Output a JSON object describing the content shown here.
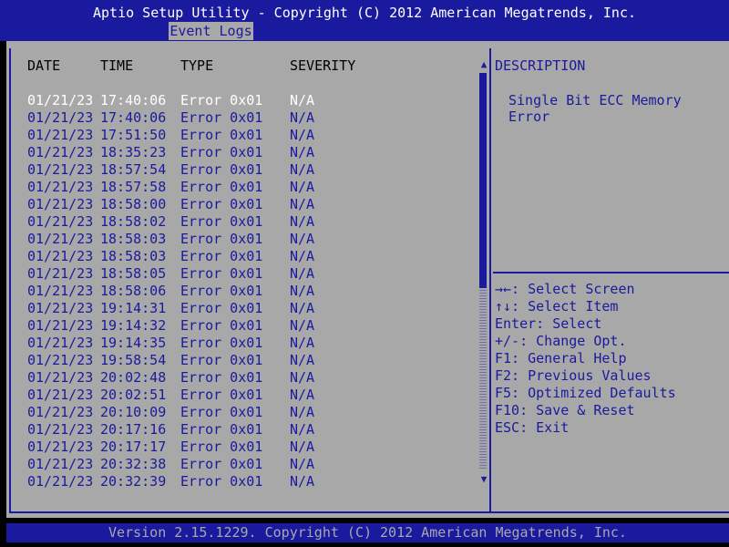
{
  "header": {
    "title": "Aptio Setup Utility - Copyright (C) 2012 American Megatrends, Inc.",
    "tab": "Event Logs"
  },
  "table": {
    "columns": [
      "DATE",
      "TIME",
      "TYPE",
      "SEVERITY"
    ],
    "rows": [
      {
        "date": "01/21/23",
        "time": "17:40:06",
        "type": "Error 0x01",
        "severity": "N/A"
      },
      {
        "date": "01/21/23",
        "time": "17:40:06",
        "type": "Error 0x01",
        "severity": "N/A"
      },
      {
        "date": "01/21/23",
        "time": "17:51:50",
        "type": "Error 0x01",
        "severity": "N/A"
      },
      {
        "date": "01/21/23",
        "time": "18:35:23",
        "type": "Error 0x01",
        "severity": "N/A"
      },
      {
        "date": "01/21/23",
        "time": "18:57:54",
        "type": "Error 0x01",
        "severity": "N/A"
      },
      {
        "date": "01/21/23",
        "time": "18:57:58",
        "type": "Error 0x01",
        "severity": "N/A"
      },
      {
        "date": "01/21/23",
        "time": "18:58:00",
        "type": "Error 0x01",
        "severity": "N/A"
      },
      {
        "date": "01/21/23",
        "time": "18:58:02",
        "type": "Error 0x01",
        "severity": "N/A"
      },
      {
        "date": "01/21/23",
        "time": "18:58:03",
        "type": "Error 0x01",
        "severity": "N/A"
      },
      {
        "date": "01/21/23",
        "time": "18:58:03",
        "type": "Error 0x01",
        "severity": "N/A"
      },
      {
        "date": "01/21/23",
        "time": "18:58:05",
        "type": "Error 0x01",
        "severity": "N/A"
      },
      {
        "date": "01/21/23",
        "time": "18:58:06",
        "type": "Error 0x01",
        "severity": "N/A"
      },
      {
        "date": "01/21/23",
        "time": "19:14:31",
        "type": "Error 0x01",
        "severity": "N/A"
      },
      {
        "date": "01/21/23",
        "time": "19:14:32",
        "type": "Error 0x01",
        "severity": "N/A"
      },
      {
        "date": "01/21/23",
        "time": "19:14:35",
        "type": "Error 0x01",
        "severity": "N/A"
      },
      {
        "date": "01/21/23",
        "time": "19:58:54",
        "type": "Error 0x01",
        "severity": "N/A"
      },
      {
        "date": "01/21/23",
        "time": "20:02:48",
        "type": "Error 0x01",
        "severity": "N/A"
      },
      {
        "date": "01/21/23",
        "time": "20:02:51",
        "type": "Error 0x01",
        "severity": "N/A"
      },
      {
        "date": "01/21/23",
        "time": "20:10:09",
        "type": "Error 0x01",
        "severity": "N/A"
      },
      {
        "date": "01/21/23",
        "time": "20:17:16",
        "type": "Error 0x01",
        "severity": "N/A"
      },
      {
        "date": "01/21/23",
        "time": "20:17:17",
        "type": "Error 0x01",
        "severity": "N/A"
      },
      {
        "date": "01/21/23",
        "time": "20:32:38",
        "type": "Error 0x01",
        "severity": "N/A"
      },
      {
        "date": "01/21/23",
        "time": "20:32:39",
        "type": "Error 0x01",
        "severity": "N/A"
      }
    ],
    "selected_index": 0,
    "scroll_up_icon": "triangle-up",
    "scroll_down_icon": "triangle-down"
  },
  "description": {
    "title": "DESCRIPTION",
    "text": "Single Bit ECC Memory Error"
  },
  "help": [
    "→←: Select Screen",
    "↑↓: Select Item",
    "Enter: Select",
    "+/-: Change Opt.",
    "F1: General Help",
    "F2: Previous Values",
    "F5: Optimized Defaults",
    "F10: Save & Reset",
    "ESC: Exit"
  ],
  "footer": {
    "text": "Version 2.15.1229. Copyright (C) 2012 American Megatrends, Inc."
  },
  "colors": {
    "accent_blue": "#1a1a9e",
    "panel_gray": "#a8a8a8",
    "selected_text": "#ffffff"
  }
}
